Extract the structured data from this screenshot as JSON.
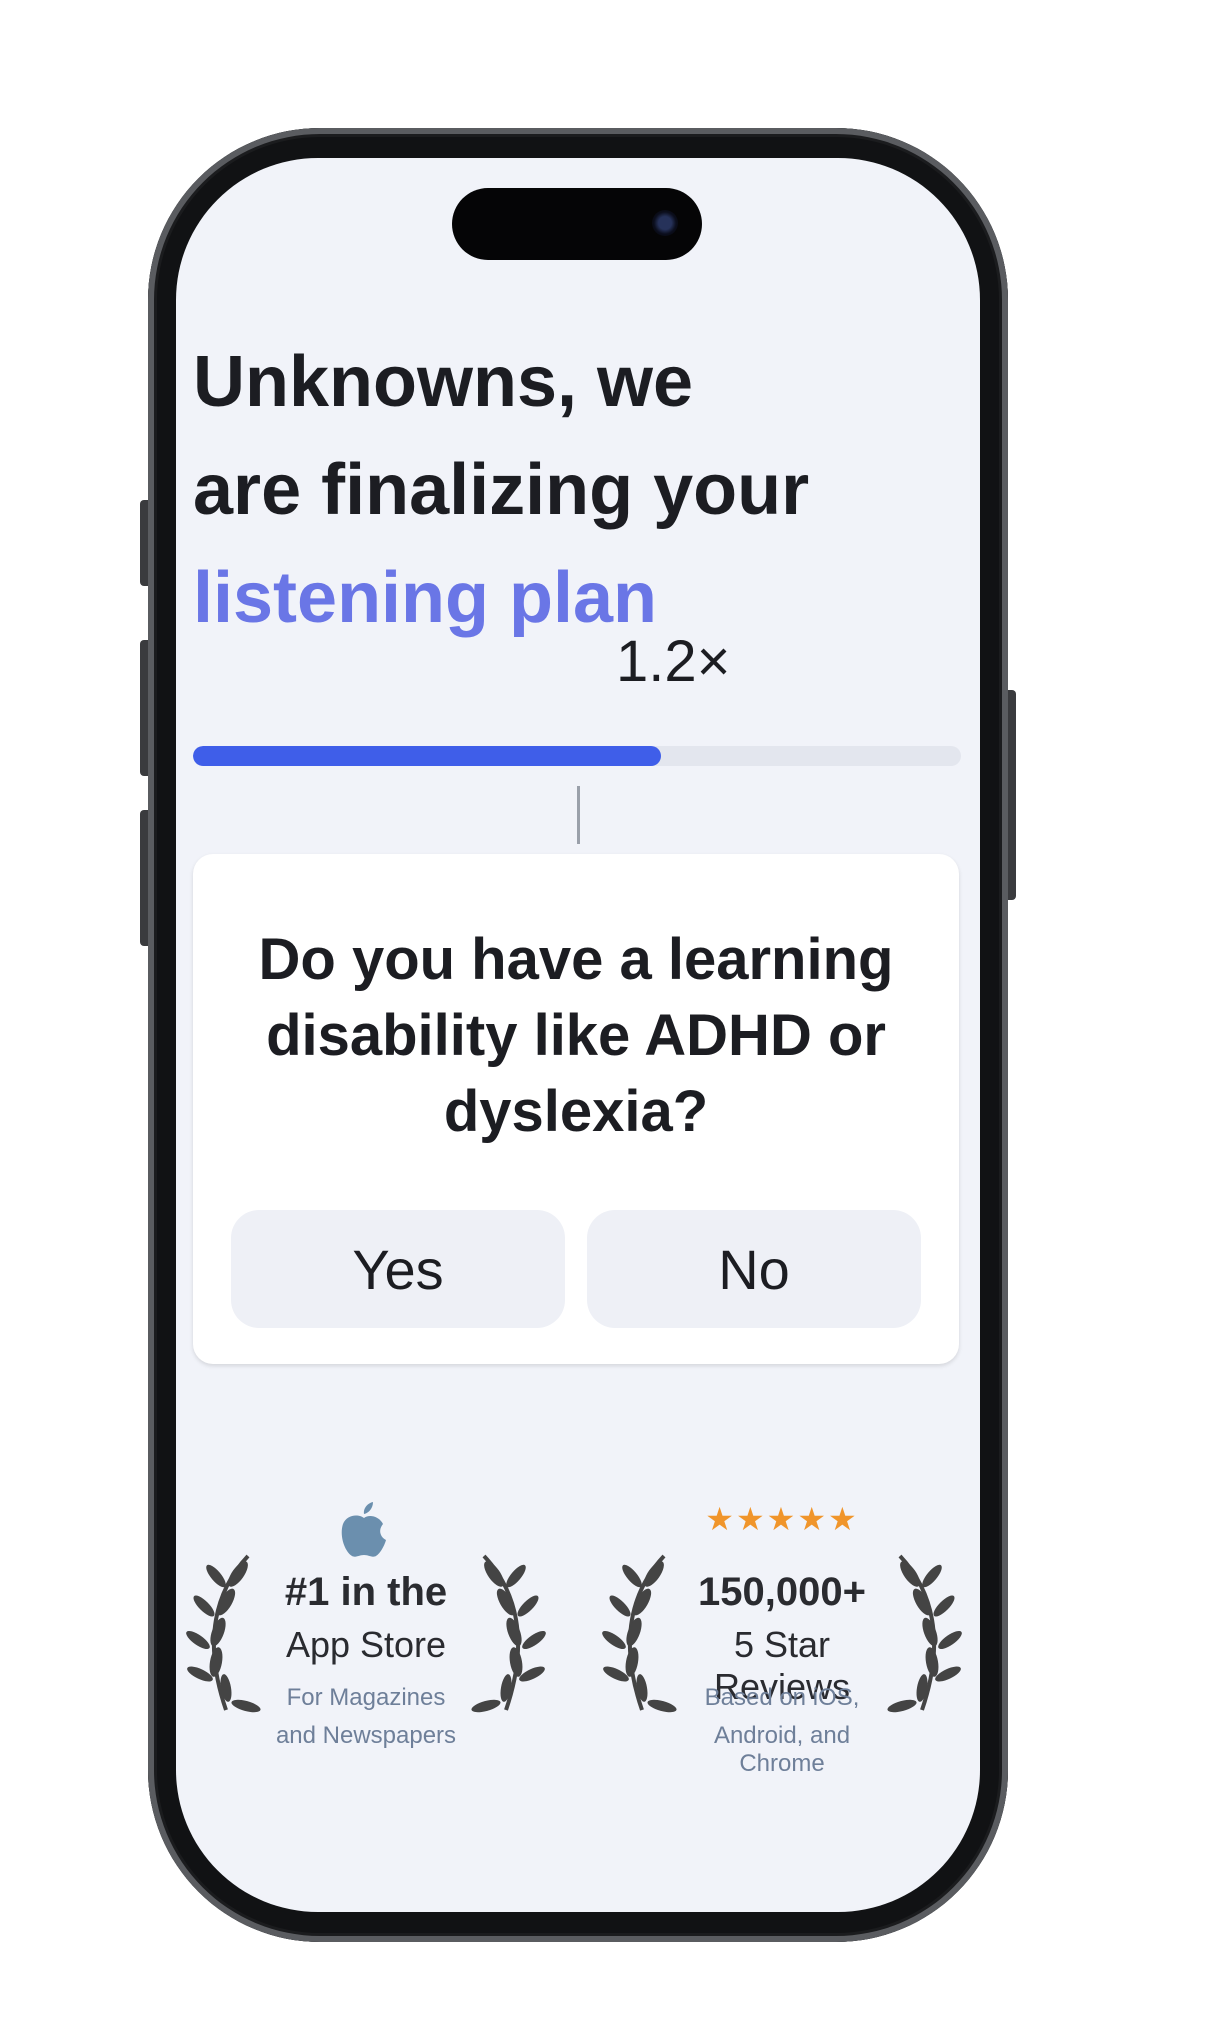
{
  "headline": {
    "line1": "Unknowns, we",
    "line2": "are finalizing your",
    "line3": "listening plan"
  },
  "speed_label": "1.2×",
  "progress": {
    "fraction": 0.61
  },
  "question": {
    "text": "Do you have a learning disability like ADHD or dyslexia?",
    "yes_label": "Yes",
    "no_label": "No"
  },
  "badges": {
    "app_store": {
      "icon": "apple-icon",
      "title_line1": "#1 in the",
      "title_line2": "App Store",
      "sub_line1": "For Magazines",
      "sub_line2": "and Newspapers"
    },
    "reviews": {
      "stars": "★★★★★",
      "title_line1": "150,000+",
      "title_line2": "5 Star Reviews",
      "sub_line1": "Based on iOS,",
      "sub_line2": "Android, and Chrome"
    }
  },
  "colors": {
    "accent": "#6a76e6",
    "progress": "#3f5ee9",
    "star": "#f0952b",
    "background": "#f1f3f9"
  }
}
